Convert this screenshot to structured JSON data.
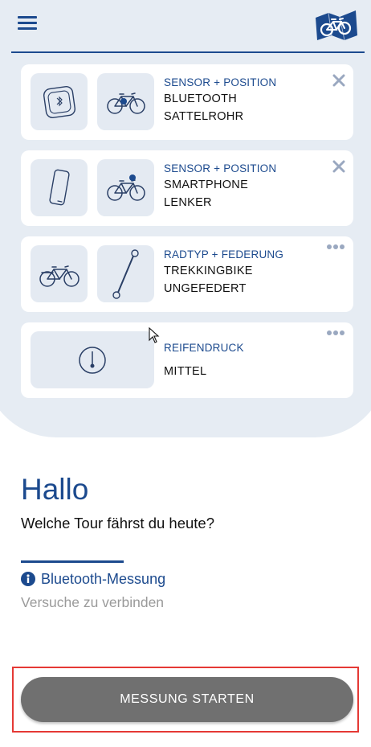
{
  "header": {
    "menu_icon": "hamburger-menu-icon",
    "logo_icon": "bike-map-logo-icon"
  },
  "cards": [
    {
      "category": "SENSOR + POSITION",
      "line1": "BLUETOOTH",
      "line2": "SATTELROHR",
      "action": "close-icon"
    },
    {
      "category": "SENSOR + POSITION",
      "line1": "SMARTPHONE",
      "line2": "LENKER",
      "action": "close-icon"
    },
    {
      "category": "RADTYP + FEDERUNG",
      "line1": "TREKKINGBIKE",
      "line2": "UNGEFEDERT",
      "action": "more-dots-icon"
    },
    {
      "category": "REIFENDRUCK",
      "line1": "MITTEL",
      "action": "more-dots-icon"
    }
  ],
  "greeting": {
    "title": "Hallo",
    "question": "Welche Tour fährst du heute?"
  },
  "status": {
    "info_icon": "i",
    "title": "Bluetooth-Messung",
    "subtitle": "Versuche zu verbinden"
  },
  "start_button": {
    "label": "MESSUNG STARTEN"
  },
  "colors": {
    "brand": "#1c4a8e",
    "panel": "#e6ecf3",
    "tile": "#e4eaf2",
    "button": "#707070",
    "highlight": "#e53935"
  }
}
